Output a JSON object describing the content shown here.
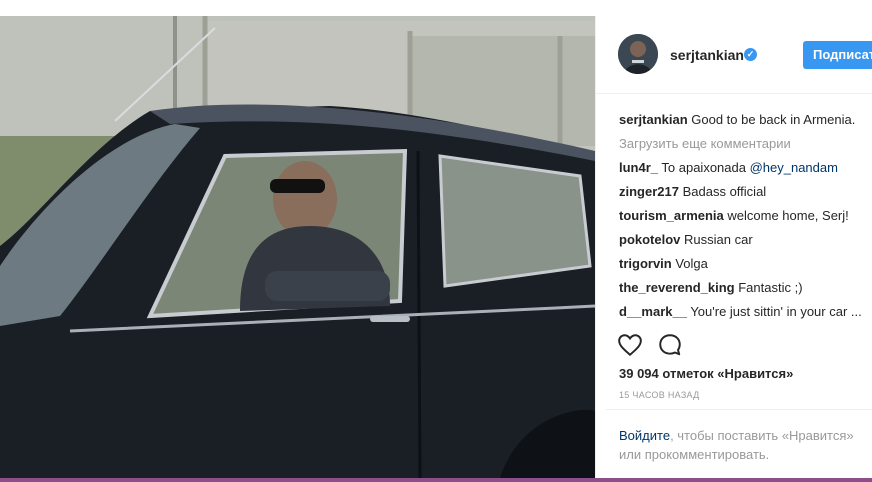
{
  "post": {
    "username": "serjtankian",
    "follow_label": "Подписаться",
    "caption": {
      "user": "serjtankian",
      "text": " Good to be back in Armenia."
    },
    "load_more": "Загрузить еще комментарии",
    "comments": [
      {
        "user": "lun4r_",
        "text": " To apaixonada ",
        "mention": "@hey_nandam"
      },
      {
        "user": "zinger217",
        "text": " Badass official"
      },
      {
        "user": "tourism_armenia",
        "text": " welcome home, Serj!"
      },
      {
        "user": "pokotelov",
        "text": " Russian car"
      },
      {
        "user": "trigorvin",
        "text": " Volga"
      },
      {
        "user": "the_reverend_king",
        "text": " Fantastic ;)"
      },
      {
        "user": "d__mark__",
        "text": " You're just sittin' in your car ..."
      }
    ],
    "likes": "39 094 отметок «Нравится»",
    "time_ago": "15 ЧАСОВ НАЗАД",
    "login_link": "Войдите",
    "login_text": ", чтобы поставить «Нравится» или прокомментировать."
  },
  "icons": {
    "like": "heart-icon",
    "comment": "comment-icon",
    "verified": "verified-badge-icon"
  },
  "colors": {
    "accent": "#3897f0",
    "muted": "#999999",
    "link": "#003569"
  }
}
